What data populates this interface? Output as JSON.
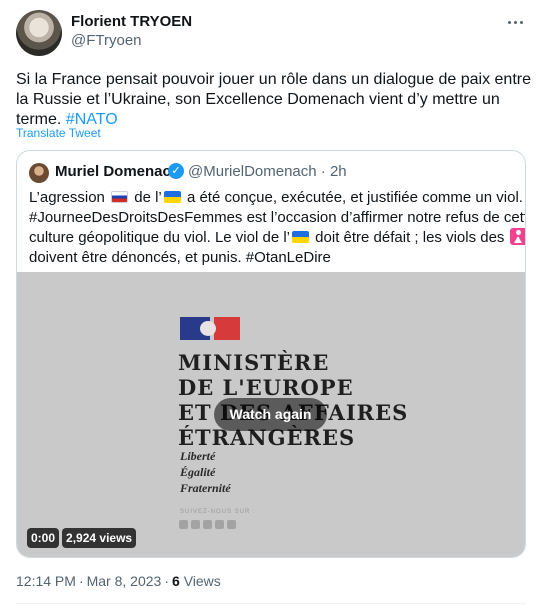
{
  "tweet": {
    "author_name": "Florient TRYOEN",
    "author_handle": "@FTryoen",
    "text_lines": [
      "Si la France pensait pouvoir jouer un rôle dans un dialogue de paix entre",
      "la Russie et l’Ukraine, son Excellence Domenach vient d’y mettre un",
      "terme."
    ],
    "hashtag": "#NATO",
    "translate_label": "Translate Tweet",
    "time": "12:14 PM",
    "date": "Mar 8, 2023",
    "views_count": "6",
    "views_label": "Views"
  },
  "quote": {
    "author_name": "Muriel Domenach",
    "author_handle": "@MurielDomenach",
    "sep": "·",
    "age": "2h",
    "l1_a": "L’agression",
    "l1_b": "de l’",
    "l1_c": "a été conçue, exécutée, et justifiée comme un viol. La",
    "l2": "#JourneeDesDroitsDesFemmes est l’occasion d’affirmer notre refus de cette",
    "l3_a": "culture géopolitique du viol. Le viol de l’",
    "l3_b": "doit être défait ; les viols des",
    "l4": "doivent être dénoncés, et punis. #OtanLeDire"
  },
  "media": {
    "title_lines": [
      "MINISTÈRE",
      "DE L'EUROPE",
      "ET DES AFFAIRES",
      "ÉTRANGÈRES"
    ],
    "motto": [
      "Liberté",
      "Égalité",
      "Fraternité"
    ],
    "follow_label": "SUIVEZ-NOUS SUR :",
    "watch_again": "Watch again",
    "time": "0:00",
    "views": "2,924 views"
  },
  "icons": {
    "more": "more-horizontal-icon",
    "verified": "verified-badge-icon",
    "flag_russia": "flag-russia-icon",
    "flag_ukraine": "flag-ukraine-icon",
    "womens": "womens-symbol-icon"
  },
  "colors": {
    "accent": "#1d9bf0",
    "text": "#0f1419",
    "muted": "#536471",
    "border": "#cfd9de"
  }
}
